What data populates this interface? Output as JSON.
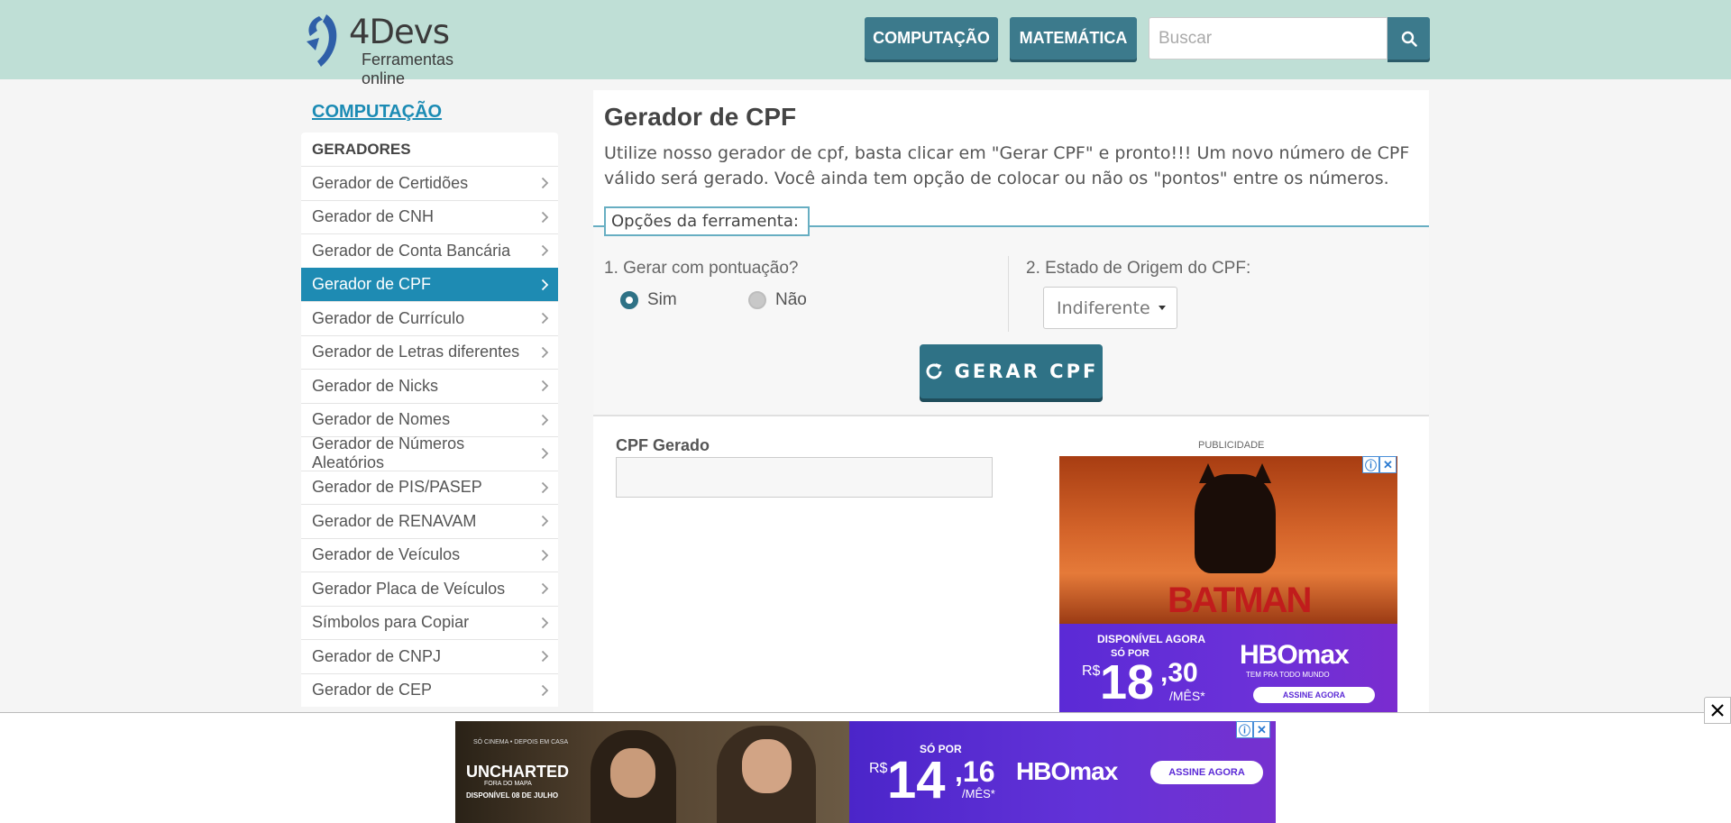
{
  "header": {
    "logo_text": "4Devs",
    "logo_sub": "Ferramentas online",
    "nav": [
      "COMPUTAÇÃO",
      "MATEMÁTICA"
    ],
    "search_placeholder": "Buscar"
  },
  "sidebar": {
    "section_title": "COMPUTAÇÃO",
    "group_title": "GERADORES",
    "items": [
      {
        "label": "Gerador de Certidões",
        "active": false
      },
      {
        "label": "Gerador de CNH",
        "active": false
      },
      {
        "label": "Gerador de Conta Bancária",
        "active": false
      },
      {
        "label": "Gerador de CPF",
        "active": true
      },
      {
        "label": "Gerador de Currículo",
        "active": false
      },
      {
        "label": "Gerador de Letras diferentes",
        "active": false
      },
      {
        "label": "Gerador de Nicks",
        "active": false
      },
      {
        "label": "Gerador de Nomes",
        "active": false
      },
      {
        "label": "Gerador de Números Aleatórios",
        "active": false
      },
      {
        "label": "Gerador de PIS/PASEP",
        "active": false
      },
      {
        "label": "Gerador de RENAVAM",
        "active": false
      },
      {
        "label": "Gerador de Veículos",
        "active": false
      },
      {
        "label": "Gerador Placa de Veículos",
        "active": false
      },
      {
        "label": "Símbolos para Copiar",
        "active": false
      },
      {
        "label": "Gerador de CNPJ",
        "active": false
      },
      {
        "label": "Gerador de CEP",
        "active": false
      }
    ]
  },
  "main": {
    "title": "Gerador de CPF",
    "description": "Utilize nosso gerador de cpf, basta clicar em \"Gerar CPF\" e pronto!!! Um novo número de CPF válido será gerado. Você ainda tem opção de colocar ou não os \"pontos\" entre os números.",
    "options_legend": "Opções da ferramenta:",
    "q1": "1. Gerar com pontuação?",
    "q1_options": [
      {
        "label": "Sim",
        "selected": true
      },
      {
        "label": "Não",
        "selected": false
      }
    ],
    "q2": "2. Estado de Origem do CPF:",
    "q2_value": "Indiferente",
    "generate_button": "GERAR CPF",
    "result_label": "CPF Gerado",
    "result_value": ""
  },
  "ads": {
    "label": "PUBLICIDADE",
    "side": {
      "movie": "BATMAN",
      "line1": "DISPONÍVEL AGORA",
      "line2": "SÓ POR",
      "currency": "R$",
      "price_int": "18",
      "price_cents": ",30",
      "per": "/MÊS*",
      "brand": "HBOmax",
      "tagline": "TEM PRA TODO MUNDO",
      "cta": "ASSINE AGORA"
    },
    "bottom": {
      "top_text": "SÓ CINEMA • DEPOIS EM CASA",
      "movie": "UNCHARTED",
      "movie_sub": "FORA DO MAPA",
      "date": "DISPONÍVEL 08 DE JULHO",
      "sopor": "SÓ POR",
      "currency": "R$",
      "price_int": "14",
      "price_cents": ",16",
      "per": "/MÊS*",
      "brand": "HBOmax",
      "cta": "ASSINE AGORA"
    }
  },
  "colors": {
    "header_bg": "#bfdfd6",
    "accent": "#3c7a8c",
    "active_item": "#1e8bb3",
    "link": "#1b8bb4"
  }
}
